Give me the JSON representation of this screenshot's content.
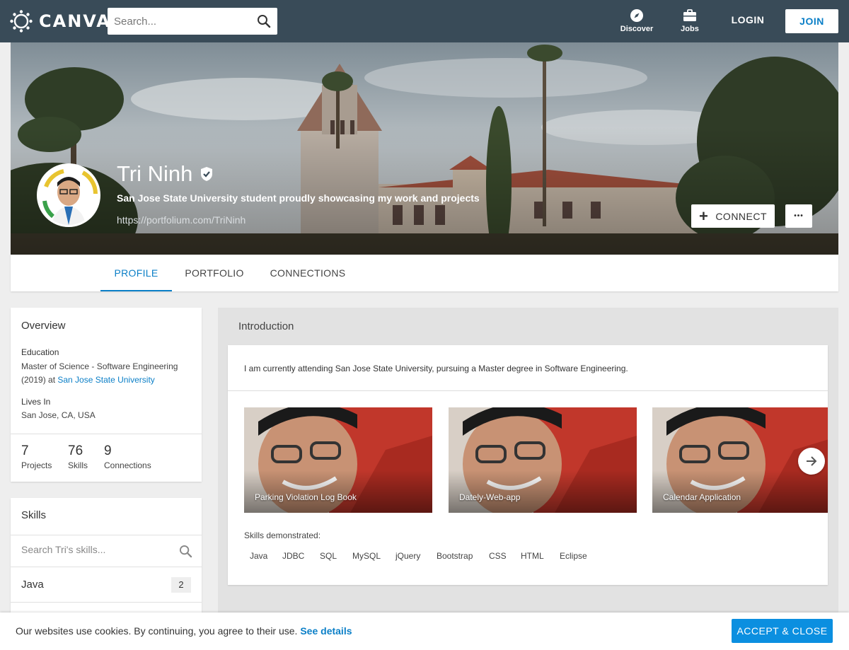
{
  "nav": {
    "logo_text": "CANVAS",
    "search_placeholder": "Search...",
    "discover_label": "Discover",
    "jobs_label": "Jobs",
    "login_label": "LOGIN",
    "join_label": "JOIN"
  },
  "profile": {
    "name": "Tri Ninh",
    "tagline": "San Jose State University student proudly showcasing my work and projects",
    "link": "https://portfolium.com/TriNinh",
    "connect_label": "CONNECT",
    "more_label": "•••"
  },
  "tabs": [
    {
      "label": "PROFILE",
      "active": true
    },
    {
      "label": "PORTFOLIO",
      "active": false
    },
    {
      "label": "CONNECTIONS",
      "active": false
    }
  ],
  "overview": {
    "title": "Overview",
    "education_label": "Education",
    "education_value": "Master of Science - Software Engineering (2019) at",
    "education_school": "San Jose State University",
    "lives_label": "Lives In",
    "lives_value": "San Jose, CA, USA",
    "stats": [
      {
        "num": "7",
        "label": "Projects"
      },
      {
        "num": "76",
        "label": "Skills"
      },
      {
        "num": "9",
        "label": "Connections"
      }
    ]
  },
  "skills": {
    "title": "Skills",
    "search_placeholder": "Search Tri's skills...",
    "items": [
      {
        "name": "Java",
        "count": "2"
      }
    ]
  },
  "introduction": {
    "title": "Introduction",
    "text": "I am currently attending San Jose State University, pursuing a Master degree in Software Engineering.",
    "projects": [
      {
        "title": "Parking Violation Log Book"
      },
      {
        "title": "Dately-Web-app"
      },
      {
        "title": "Calendar Application"
      }
    ],
    "skills_label": "Skills demonstrated:",
    "skill_tags": [
      "Java",
      "JDBC",
      "SQL",
      "MySQL",
      "jQuery",
      "Bootstrap",
      "CSS",
      "HTML",
      "Eclipse"
    ]
  },
  "cookie": {
    "text": "Our websites use cookies. By continuing, you agree to their use.",
    "link": "See details",
    "accept_label": "ACCEPT & CLOSE"
  },
  "colors": {
    "nav_bg": "#394b58",
    "accent": "#0b7fc7",
    "accept_bg": "#0b8fe0"
  }
}
